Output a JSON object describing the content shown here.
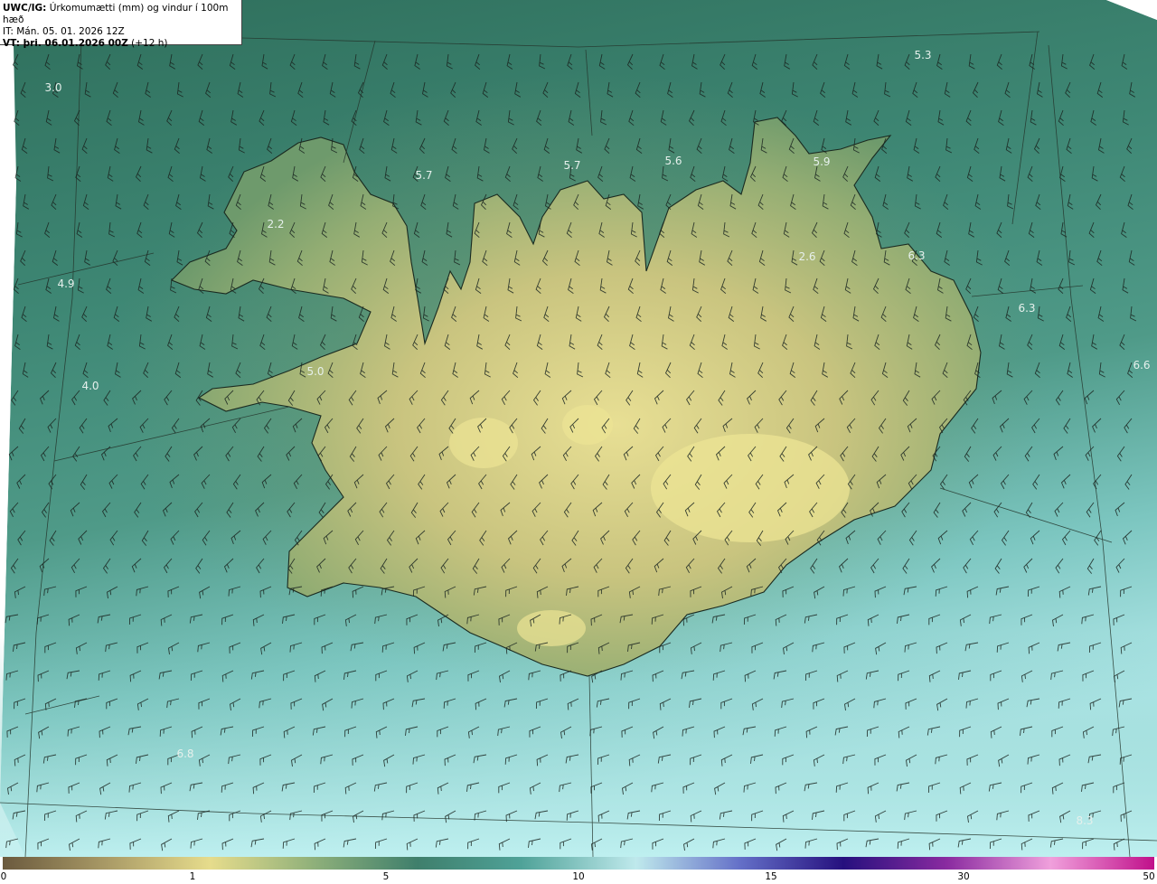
{
  "header": {
    "line1_bold": "UWC/IG:",
    "line1_rest": " Úrkomumætti (mm) og vindur í 100m hæð",
    "line2": "IT: Mán. 05. 01. 2026 12Z",
    "line3_bold": "VT: þri. 06.01.2026 00Z",
    "line3_rest": " (+12 h)"
  },
  "value_labels": [
    {
      "text": "3.0"
    },
    {
      "text": "5.3"
    },
    {
      "text": "5.7"
    },
    {
      "text": "5.7"
    },
    {
      "text": "5.6"
    },
    {
      "text": "5.9"
    },
    {
      "text": "2.2"
    },
    {
      "text": "2.6"
    },
    {
      "text": "6.3"
    },
    {
      "text": "6.3"
    },
    {
      "text": "4.9"
    },
    {
      "text": "5.0"
    },
    {
      "text": "4.0"
    },
    {
      "text": "6.6"
    },
    {
      "text": "6.8"
    },
    {
      "text": "8.3"
    }
  ],
  "colorbar": {
    "ticks": [
      "0",
      "1",
      "5",
      "10",
      "15",
      "30",
      "50"
    ],
    "colors": [
      "#6b5a3e",
      "#a99a66",
      "#e6dc8c",
      "#8fb07a",
      "#3f7f6c",
      "#4fa298",
      "#bfe9ec",
      "#6470c8",
      "#26107e",
      "#8a2ba0",
      "#f0a0dc",
      "#c0108a"
    ]
  },
  "map": {
    "ocean_colors": [
      "#2f7060",
      "#3d8a79",
      "#5aa79a",
      "#9fdfe0"
    ],
    "land_colors": [
      "#8ea870",
      "#c4c27e",
      "#e5de92"
    ]
  }
}
